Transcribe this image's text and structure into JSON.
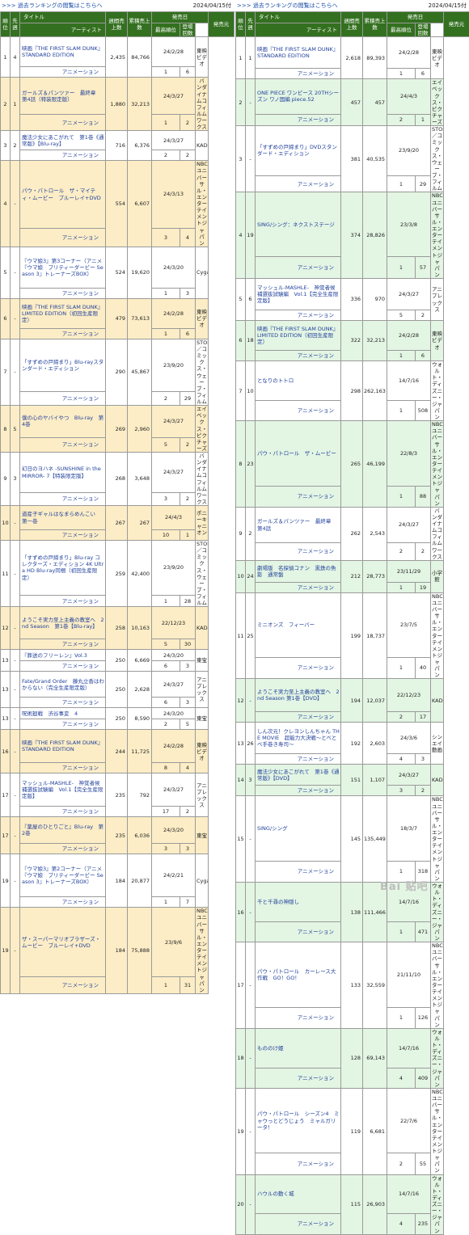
{
  "left": {
    "link_text": "過去ランキングの閲覧はこちらへ",
    "link_prefix": ">>>",
    "date": "2024/04/15付",
    "header": {
      "rank": "順位",
      "prev": "先週",
      "title": "タイトル",
      "artist": "アーティスト",
      "week_sales": "週間売上数",
      "total_sales": "累積売上数",
      "release": "発売日",
      "highest": "最高順位",
      "weeks": "登場回数",
      "maker": "発売元"
    },
    "rows": [
      {
        "rank": "1",
        "prev": "4",
        "title": "映画『THE FIRST SLAM DUNK』STANDARD EDITION",
        "genre": "アニメーション",
        "week": "2,435",
        "total": "84,766",
        "date": "24/2/28",
        "best": "1",
        "weeks": "6",
        "maker": "東映ビデオ",
        "h": 50,
        "style": "w"
      },
      {
        "rank": "2",
        "prev": "1",
        "title": "ガールズ＆パンツァー　最終章　第4話（特装限定版）",
        "genre": "アニメーション",
        "week": "1,880",
        "total": "32,213",
        "date": "24/3/27",
        "best": "1",
        "weeks": "2",
        "maker": "バンダイナムコフィルムワークス",
        "h": 43,
        "style": "hi"
      },
      {
        "rank": "3",
        "prev": "2",
        "title": "魔法少女にあこがれて　第1巻《通常版》【Blu-ray】",
        "genre": "アニメーション",
        "week": "716",
        "total": "6,376",
        "date": "24/3/27",
        "best": "2",
        "weeks": "2",
        "maker": "KADOKAWA",
        "h": 37,
        "style": "w"
      },
      {
        "rank": "4",
        "prev": "-",
        "title": "パウ・パトロール　ザ・マイティ・ムービー　ブルーレイ+DVD",
        "genre": "アニメーション",
        "week": "554",
        "total": "6,607",
        "date": "24/3/13",
        "best": "3",
        "weeks": "4",
        "maker": "NBCユニバーサル・エンターテイメントジャパン",
        "h": 60,
        "style": "hi"
      },
      {
        "rank": "5",
        "prev": "-",
        "title": "『ウマ娘3』第3コーナー（アニメ『ウマ娘　プリティーダービー Season 3』トレーナーズBOX）",
        "genre": "アニメーション",
        "week": "524",
        "total": "19,620",
        "date": "24/3/20",
        "best": "1",
        "weeks": "3",
        "maker": "Cygames",
        "h": 64,
        "style": "w"
      },
      {
        "rank": "6",
        "prev": "-",
        "title": "映画『THE FIRST SLAM DUNK』LIMITED EDITION（初回生産限定）",
        "genre": "アニメーション",
        "week": "479",
        "total": "73,613",
        "date": "24/2/28",
        "best": "1",
        "weeks": "6",
        "maker": "東映ビデオ",
        "h": 50,
        "style": "hi"
      },
      {
        "rank": "7",
        "prev": "-",
        "title": "「すずめの戸締まり」Blu-rayスタンダード・エディション",
        "genre": "アニメーション",
        "week": "290",
        "total": "45,867",
        "date": "23/9/20",
        "best": "2",
        "weeks": "29",
        "maker": "STORY／コミックス・ウェーブ・フィルム",
        "h": 62,
        "style": "w"
      },
      {
        "rank": "8",
        "prev": "5",
        "title": "僕の心のヤバイやつ　Blu-ray　第4巻",
        "genre": "アニメーション",
        "week": "269",
        "total": "2,960",
        "date": "24/3/27",
        "best": "5",
        "weeks": "2",
        "maker": "エイベックス・ピクチャーズ",
        "h": 41,
        "style": "hi"
      },
      {
        "rank": "9",
        "prev": "3",
        "title": "幻日のヨハネ -SUNSHINE in the MIRROR- 7【特装限定版】",
        "genre": "アニメーション",
        "week": "268",
        "total": "3,648",
        "date": "24/3/27",
        "best": "3",
        "weeks": "2",
        "maker": "バンダイナムコフィルムワークス",
        "h": 54,
        "style": "w"
      },
      {
        "rank": "10",
        "prev": "-",
        "title": "道産子ギャルはなまらめんこい　第一巻",
        "genre": "アニメーション",
        "week": "267",
        "total": "267",
        "date": "24/4/3",
        "best": "10",
        "weeks": "1",
        "maker": "ポニーキャニオン",
        "h": 43,
        "style": "hi"
      },
      {
        "rank": "11",
        "prev": "-",
        "title": "「すずめの戸締まり」Blu-ray コレクターズ・エディション 4K Ultra HD Blu-ray同梱（初回生産限定）",
        "genre": "アニメーション",
        "week": "259",
        "total": "42,400",
        "date": "23/9/20",
        "best": "1",
        "weeks": "28",
        "maker": "STORY／コミックス・ウェーブ・フィルム",
        "h": 75,
        "style": "w"
      },
      {
        "rank": "12",
        "prev": "-",
        "title": "ようこそ実力至上主義の教室へ　2nd Season　第1巻【Blu-ray】",
        "genre": "アニメーション",
        "week": "258",
        "total": "10,163",
        "date": "22/12/23",
        "best": "5",
        "weeks": "30",
        "maker": "KADOKAWA",
        "h": 53,
        "style": "hi"
      },
      {
        "rank": "13",
        "prev": "-",
        "title": "『葬送のフリーレン』Vol.3",
        "genre": "アニメーション",
        "week": "250",
        "total": "6,669",
        "date": "24/3/20",
        "best": "6",
        "weeks": "3",
        "maker": "東宝",
        "h": 27,
        "style": "w"
      },
      {
        "rank": "13",
        "prev": "-",
        "title": "Fate/Grand Order　藤丸立香はわからない（完全生産限定版）",
        "genre": "アニメーション",
        "week": "250",
        "total": "2,628",
        "date": "24/3/27",
        "best": "6",
        "weeks": "3",
        "maker": "アニプレックス",
        "h": 45,
        "style": "w"
      },
      {
        "rank": "13",
        "prev": "-",
        "title": "呪術廻戦　渋谷事変　4",
        "genre": "アニメーション",
        "week": "250",
        "total": "8,590",
        "date": "24/3/20",
        "best": "2",
        "weeks": "5",
        "maker": "東宝",
        "h": 27,
        "style": "w"
      },
      {
        "rank": "16",
        "prev": "-",
        "title": "映画『THE FIRST SLAM DUNK』STANDARD EDITION",
        "genre": "アニメーション",
        "week": "244",
        "total": "11,725",
        "date": "24/2/28",
        "best": "8",
        "weeks": "4",
        "maker": "東映ビデオ",
        "h": 54,
        "style": "hi"
      },
      {
        "rank": "17",
        "prev": "-",
        "title": "マッシュル-MASHLE-　神覚者候補選抜試験編　Vol.1【完全生産限定版】",
        "genre": "アニメーション",
        "week": "235",
        "total": "792",
        "date": "24/3/27",
        "best": "17",
        "weeks": "2",
        "maker": "アニプレックス",
        "h": 54,
        "style": "w"
      },
      {
        "rank": "17",
        "prev": "-",
        "title": "『薬屋のひとりごと』Blu-ray　第2巻",
        "genre": "アニメーション",
        "week": "235",
        "total": "6,036",
        "date": "24/3/20",
        "best": "3",
        "weeks": "3",
        "maker": "東宝",
        "h": 46,
        "style": "hi"
      },
      {
        "rank": "19",
        "prev": "-",
        "title": "『ウマ娘3』第2コーナー（アニメ『ウマ娘　プリティーダービー Season 3』トレーナーズBOX）",
        "genre": "アニメーション",
        "week": "184",
        "total": "20,877",
        "date": "24/2/21",
        "best": "1",
        "weeks": "7",
        "maker": "Cygames",
        "h": 66,
        "style": "w"
      },
      {
        "rank": "19",
        "prev": "-",
        "title": "ザ・スーパーマリオブラザーズ・ムービー　ブルーレイ+DVD",
        "genre": "アニメーション",
        "week": "184",
        "total": "75,888",
        "date": "23/9/6",
        "best": "1",
        "weeks": "31",
        "maker": "NBCユニバーサル・エンターテイメントジャパン",
        "h": 68,
        "style": "hi"
      }
    ]
  },
  "right": {
    "link_text": "過去ランキングの閲覧はこちらへ",
    "link_prefix": ">>>",
    "date": "2024/04/15付",
    "header": {
      "rank": "順位",
      "prev": "先週",
      "title": "タイトル",
      "artist": "アーティスト",
      "week_sales": "週間売上数",
      "total_sales": "累積売上数",
      "release": "発売日",
      "highest": "最高順位",
      "weeks": "登場回数",
      "maker": "発売元"
    },
    "rows": [
      {
        "rank": "1",
        "prev": "1",
        "title": "映画『THE FIRST SLAM DUNK』STANDARD EDITION",
        "genre": "アニメーション",
        "week": "2,618",
        "total": "89,393",
        "date": "24/2/28",
        "best": "1",
        "weeks": "6",
        "maker": "東映ビデオ",
        "h": 52,
        "style": "w"
      },
      {
        "rank": "2",
        "prev": "-",
        "title": "ONE PIECE ワンピース 20THシーズン ワノ国編 piece.52",
        "genre": "アニメーション",
        "week": "457",
        "total": "457",
        "date": "24/4/3",
        "best": "2",
        "weeks": "1",
        "maker": "エイベックス・ピクチャーズ",
        "h": 52,
        "style": "hg"
      },
      {
        "rank": "3",
        "prev": "-",
        "title": "「すずめの戸締まり」DVDスタンダード・エディション",
        "genre": "アニメーション",
        "week": "381",
        "total": "40,535",
        "date": "23/9/20",
        "best": "1",
        "weeks": "29",
        "maker": "STORY／コミックス・ウェーブ・フィルム",
        "h": 52,
        "style": "w"
      },
      {
        "rank": "4",
        "prev": "19",
        "title": "SING/シング：ネクストステージ",
        "genre": "アニメーション",
        "week": "374",
        "total": "28,826",
        "date": "23/3/8",
        "best": "1",
        "weeks": "57",
        "maker": "NBCユニバーサル・エンターテイメントジャパン",
        "h": 52,
        "style": "hg"
      },
      {
        "rank": "5",
        "prev": "6",
        "title": "マッシュル-MASHLE-　神覚者候補選抜試験編　Vol.1【完全生産限定版】",
        "genre": "アニメーション",
        "week": "336",
        "total": "970",
        "date": "24/3/27",
        "best": "5",
        "weeks": "2",
        "maker": "アニプレックス",
        "h": 52,
        "style": "w"
      },
      {
        "rank": "6",
        "prev": "18",
        "title": "映画『THE FIRST SLAM DUNK』LIMITED EDITION（初回生産限定）",
        "genre": "アニメーション",
        "week": "322",
        "total": "32,213",
        "date": "24/2/28",
        "best": "1",
        "weeks": "6",
        "maker": "東映ビデオ",
        "h": 50,
        "style": "hg"
      },
      {
        "rank": "7",
        "prev": "10",
        "title": "となりのトトロ",
        "genre": "アニメーション",
        "week": "298",
        "total": "262,163",
        "date": "14/7/16",
        "best": "1",
        "weeks": "508",
        "maker": "ウォルト・ディズニー・ジャパン",
        "h": 38,
        "style": "w"
      },
      {
        "rank": "8",
        "prev": "23",
        "title": "パウ・パトロール　ザ・ムービー",
        "genre": "アニメーション",
        "week": "265",
        "total": "46,199",
        "date": "22/8/3",
        "best": "1",
        "weeks": "88",
        "maker": "NBCユニバーサル・エンターテイメントジャパン",
        "h": 53,
        "style": "hg"
      },
      {
        "rank": "9",
        "prev": "2",
        "title": "ガールズ＆パンツァー　最終章　第4話",
        "genre": "アニメーション",
        "week": "262",
        "total": "2,543",
        "date": "24/3/27",
        "best": "2",
        "weeks": "2",
        "maker": "バンダイナムコフィルムワークス",
        "h": 40,
        "style": "w"
      },
      {
        "rank": "10",
        "prev": "24",
        "title": "劇場版　名探偵コナン　黒鉄の魚影　通常盤",
        "genre": "アニメーション",
        "week": "212",
        "total": "28,773",
        "date": "23/11/29",
        "best": "1",
        "weeks": "19",
        "maker": "小学館",
        "h": 40,
        "style": "hg"
      },
      {
        "rank": "11",
        "prev": "25",
        "title": "ミニオンズ　フィーバー",
        "genre": "アニメーション",
        "week": "199",
        "total": "18,737",
        "date": "23/7/5",
        "best": "1",
        "weeks": "40",
        "maker": "NBCユニバーサル・エンターテイメントジャパン",
        "h": 52,
        "style": "w"
      },
      {
        "rank": "12",
        "prev": "-",
        "title": "ようこそ実力至上主義の教室へ　2nd Season 第1巻【DVD】",
        "genre": "アニメーション",
        "week": "194",
        "total": "12,037",
        "date": "22/12/23",
        "best": "2",
        "weeks": "17",
        "maker": "KADOKAWA",
        "h": 54,
        "style": "hg"
      },
      {
        "rank": "13",
        "prev": "26",
        "title": "しん次元！クレヨンしんちゃん THE MOVIE　超能力大決戦～とべとべ手巻き寿司～",
        "genre": "アニメーション",
        "week": "192",
        "total": "2,603",
        "date": "24/3/6",
        "best": "4",
        "weeks": "3",
        "maker": "シンエイ動画",
        "h": 52,
        "style": "w"
      },
      {
        "rank": "14",
        "prev": "3",
        "title": "魔法少女にあこがれて　第1巻《通常版》【DVD】",
        "genre": "アニメーション",
        "week": "151",
        "total": "1,107",
        "date": "24/3/27",
        "best": "3",
        "weeks": "2",
        "maker": "KADOKAWA",
        "h": 39,
        "style": "hg"
      },
      {
        "rank": "15",
        "prev": "-",
        "title": "SING/シング",
        "genre": "アニメーション",
        "week": "145",
        "total": "135,449",
        "date": "18/3/7",
        "best": "1",
        "weeks": "318",
        "maker": "NBCユニバーサル・エンターテイメントジャパン",
        "h": 53,
        "style": "w"
      },
      {
        "rank": "16",
        "prev": "-",
        "title": "千と千尋の神隠し",
        "genre": "アニメーション",
        "week": "138",
        "total": "111,466",
        "date": "14/7/16",
        "best": "1",
        "weeks": "471",
        "maker": "ウォルト・ディズニー・ジャパン",
        "h": 38,
        "style": "hg"
      },
      {
        "rank": "17",
        "prev": "-",
        "title": "パウ・パトロール　カーレース大作戦　GO！GO！",
        "genre": "アニメーション",
        "week": "133",
        "total": "32,559",
        "date": "21/11/10",
        "best": "1",
        "weeks": "126",
        "maker": "NBCユニバーサル・エンターテイメントジャパン",
        "h": 53,
        "style": "w"
      },
      {
        "rank": "18",
        "prev": "-",
        "title": "もののけ姫",
        "genre": "アニメーション",
        "week": "128",
        "total": "69,143",
        "date": "14/7/16",
        "best": "4",
        "weeks": "409",
        "maker": "ウォルト・ディズニー・ジャパン",
        "h": 38,
        "style": "hg"
      },
      {
        "rank": "19",
        "prev": "-",
        "title": "パウ・パトロール　シーズン4　ミャウっとどうじょう　ミャルガリータ！",
        "genre": "アニメーション",
        "week": "119",
        "total": "6,681",
        "date": "22/7/6",
        "best": "2",
        "weeks": "55",
        "maker": "NBCユニバーサル・エンターテイメントジャパン",
        "h": 53,
        "style": "w"
      },
      {
        "rank": "20",
        "prev": "-",
        "title": "ハウルの動く城",
        "genre": "アニメーション",
        "week": "115",
        "total": "26,903",
        "date": "14/7/16",
        "best": "4",
        "weeks": "235",
        "maker": "ウォルト・ディズニー・ジャパン",
        "h": 38,
        "style": "hg"
      }
    ]
  },
  "watermark": "Bai 贴吧"
}
